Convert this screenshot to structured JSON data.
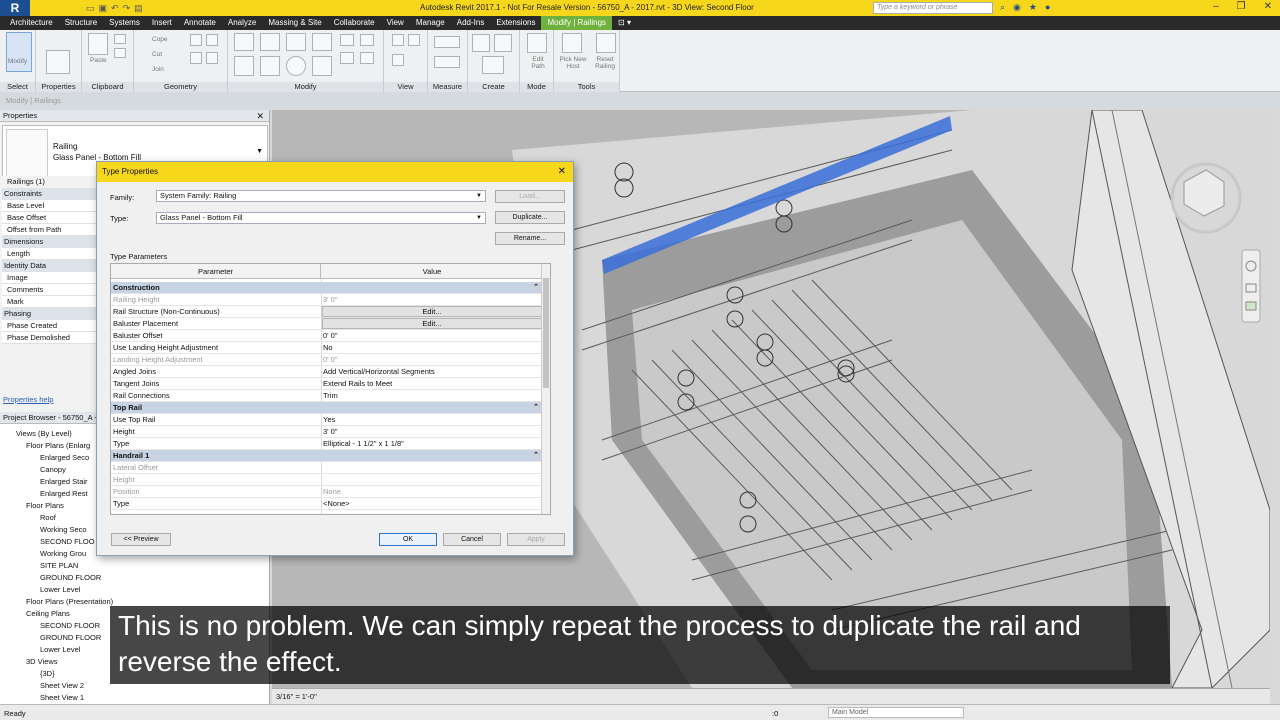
{
  "app": {
    "logo": "R",
    "title": "Autodesk Revit 2017.1 - Not For Resale Version -    56750_A - 2017.rvt - 3D View: Second Floor",
    "search_placeholder": "Type a keyword or phrase"
  },
  "ribbon_tabs": [
    "Architecture",
    "Structure",
    "Systems",
    "Insert",
    "Annotate",
    "Analyze",
    "Massing & Site",
    "Collaborate",
    "View",
    "Manage",
    "Add-Ins",
    "Extensions",
    "Modify | Railings"
  ],
  "ribbon": {
    "panels": {
      "select": "Select",
      "properties": "Properties",
      "clipboard": "Clipboard",
      "geometry": "Geometry",
      "modify": "Modify",
      "view": "View",
      "measure": "Measure",
      "create": "Create",
      "mode": "Mode",
      "tools": "Tools"
    },
    "buttons": {
      "modify": "Modify",
      "paste": "Paste",
      "cope": "Cope",
      "cut": "Cut",
      "join": "Join",
      "edit_path": "Edit Path",
      "pick_new_host": "Pick New Host",
      "reset_railing": "Reset Railing"
    },
    "context": "Modify | Railings"
  },
  "properties": {
    "header": "Properties",
    "type_family": "Railing",
    "type_name": "Glass Panel - Bottom Fill",
    "count": "Railings (1)",
    "rows": [
      {
        "label": "Constraints",
        "group": true
      },
      {
        "label": "Base Level",
        "group": false
      },
      {
        "label": "Base Offset",
        "group": false
      },
      {
        "label": "Offset from Path",
        "group": false
      },
      {
        "label": "Dimensions",
        "group": true
      },
      {
        "label": "Length",
        "group": false
      },
      {
        "label": "Identity Data",
        "group": true
      },
      {
        "label": "Image",
        "group": false
      },
      {
        "label": "Comments",
        "group": false
      },
      {
        "label": "Mark",
        "group": false
      },
      {
        "label": "Phasing",
        "group": true
      },
      {
        "label": "Phase Created",
        "group": false
      },
      {
        "label": "Phase Demolished",
        "group": false
      }
    ],
    "help": "Properties help"
  },
  "browser": {
    "header": "Project Browser - 56750_A - 2",
    "items": [
      "Views (By Level)",
      "Floor Plans (Enlarg",
      "Enlarged Seco",
      "Canopy",
      "Enlarged Stair",
      "Enlarged Rest",
      "Floor Plans",
      "Roof",
      "Working Seco",
      "SECOND FLOO",
      "Working Grou",
      "SITE PLAN",
      "GROUND FLOOR",
      "Lower Level",
      "Floor Plans (Presentation)",
      "Ceiling Plans",
      "SECOND FLOOR",
      "GROUND FLOOR",
      "Lower Level",
      "3D Views",
      "{3D}",
      "Sheet View 2",
      "Sheet View 1"
    ]
  },
  "view_controls": {
    "scale": "3/16\" = 1'-0\""
  },
  "statusbar": {
    "ready": "Ready",
    "zero": ":0",
    "model": "Main Model"
  },
  "dialog": {
    "title": "Type Properties",
    "family_label": "Family:",
    "family_value": "System Family: Railing",
    "type_label": "Type:",
    "type_value": "Glass Panel - Bottom Fill",
    "load": "Load...",
    "duplicate": "Duplicate...",
    "rename": "Rename...",
    "type_parameters": "Type Parameters",
    "col_parameter": "Parameter",
    "col_value": "Value",
    "rows": [
      {
        "kind": "group",
        "p": "Construction",
        "v": ""
      },
      {
        "kind": "dis",
        "p": "Railing Height",
        "v": "3'  0\""
      },
      {
        "kind": "edit",
        "p": "Rail Structure (Non-Continuous)",
        "v": "Edit..."
      },
      {
        "kind": "edit",
        "p": "Baluster Placement",
        "v": "Edit..."
      },
      {
        "kind": "row",
        "p": "Baluster Offset",
        "v": "0'  0\""
      },
      {
        "kind": "row",
        "p": "Use Landing Height Adjustment",
        "v": "No"
      },
      {
        "kind": "dis",
        "p": "Landing Height Adjustment",
        "v": "0'  0\""
      },
      {
        "kind": "row",
        "p": "Angled Joins",
        "v": "Add Vertical/Horizontal Segments"
      },
      {
        "kind": "row",
        "p": "Tangent Joins",
        "v": "Extend Rails to Meet"
      },
      {
        "kind": "row",
        "p": "Rail Connections",
        "v": "Trim"
      },
      {
        "kind": "group",
        "p": "Top Rail",
        "v": ""
      },
      {
        "kind": "row",
        "p": "Use Top Rail",
        "v": "Yes"
      },
      {
        "kind": "row",
        "p": "Height",
        "v": "3'  0\""
      },
      {
        "kind": "row",
        "p": "Type",
        "v": "Elliptical - 1 1/2\" x 1 1/8\""
      },
      {
        "kind": "group",
        "p": "Handrail 1",
        "v": ""
      },
      {
        "kind": "dis",
        "p": "Lateral Offset",
        "v": ""
      },
      {
        "kind": "dis",
        "p": "Height",
        "v": ""
      },
      {
        "kind": "dis",
        "p": "Position",
        "v": "None"
      },
      {
        "kind": "row",
        "p": "Type",
        "v": "<None>"
      }
    ],
    "preview": "<< Preview",
    "ok": "OK",
    "cancel": "Cancel",
    "apply": "Apply"
  },
  "subtitle": "This is no problem. We can simply repeat the process to duplicate the rail and reverse the effect.",
  "colors": {
    "accent": "#f6d71b",
    "context_tab": "#6fb13c",
    "selected_rail": "#3a6fd8"
  }
}
